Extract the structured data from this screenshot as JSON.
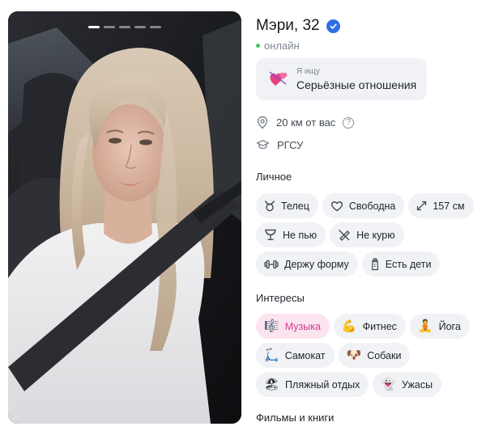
{
  "profile": {
    "name_age": "Мэри, 32",
    "status": "онлайн",
    "photo_count": 5,
    "photo_active": 1
  },
  "seeking": {
    "label": "Я ищу",
    "value": "Серьёзные отношения"
  },
  "info": {
    "distance": "20 км от вас",
    "distance_help": "?",
    "education": "РГСУ"
  },
  "sections": {
    "personal": "Личное",
    "interests": "Интересы",
    "movies_books": "Фильмы и книги"
  },
  "personal": [
    {
      "icon": "taurus-icon",
      "label": "Телец"
    },
    {
      "icon": "heart-outline-icon",
      "label": "Свободна"
    },
    {
      "icon": "expand-arrows-icon",
      "label": "157 см"
    },
    {
      "icon": "glass-icon",
      "label": "Не пью"
    },
    {
      "icon": "no-smoking-icon",
      "label": "Не курю"
    },
    {
      "icon": "dumbbell-icon",
      "label": "Держу форму"
    },
    {
      "icon": "baby-bottle-icon",
      "label": "Есть дети"
    }
  ],
  "interests": [
    {
      "icon": "music-score-icon",
      "emoji": "🎼",
      "label": "Музыка",
      "selected": true
    },
    {
      "icon": "flexed-biceps-icon",
      "emoji": "💪",
      "label": "Фитнес",
      "selected": false
    },
    {
      "icon": "yoga-icon",
      "emoji": "🧘",
      "label": "Йога",
      "selected": false
    },
    {
      "icon": "scooter-icon",
      "emoji": "🛴",
      "label": "Самокат",
      "selected": false
    },
    {
      "icon": "dog-icon",
      "emoji": "🐶",
      "label": "Собаки",
      "selected": false
    },
    {
      "icon": "beach-icon",
      "emoji": "🏖",
      "label": "Пляжный отдых",
      "selected": false
    },
    {
      "icon": "ghost-icon",
      "emoji": "👻",
      "label": "Ужасы",
      "selected": false
    }
  ],
  "colors": {
    "accent": "#2f6ee6",
    "online": "#45c266",
    "chip_bg": "#f0f2f5",
    "chip_selected_bg": "#fbe4f0",
    "chip_selected_text": "#d23b8b"
  }
}
